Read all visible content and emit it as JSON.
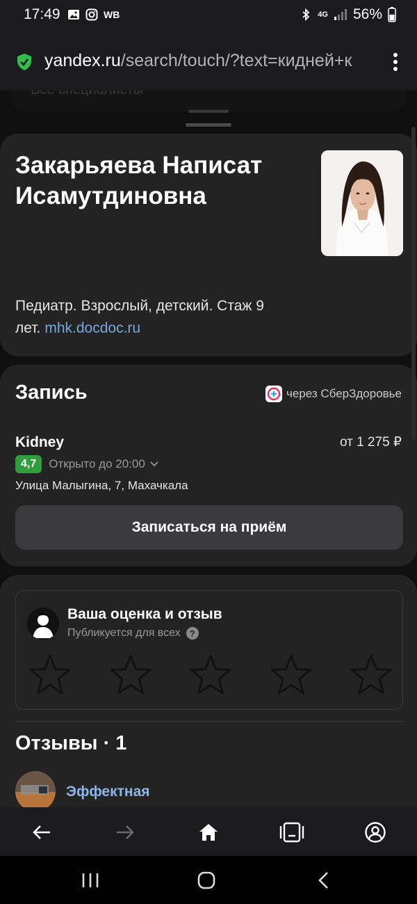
{
  "status_bar": {
    "time": "17:49",
    "carrier_label": "WB",
    "network": "4G",
    "battery": "56%"
  },
  "browser": {
    "url_host": "yandex.ru",
    "url_path": "/search/touch/?text=кидней+к"
  },
  "background_sheet": {
    "label": "Все специалисты"
  },
  "doctor": {
    "name": "Закарьяева Написат Исамутдиновна",
    "description": "Педиатр. Взрослый, детский. Стаж 9 лет.",
    "source_link": "mhk.docdoc.ru"
  },
  "booking": {
    "title": "Запись",
    "via": "через СберЗдоровье",
    "clinic_name": "Kidney",
    "price": "от 1 275 ₽",
    "rating": "4,7",
    "open_status": "Открыто до 20:00",
    "address": "Улица Малыгина, 7, Махачкала",
    "book_button": "Записаться на приём"
  },
  "rate": {
    "title": "Ваша оценка и отзыв",
    "subtitle": "Публикуется для всех",
    "stars_total": 5,
    "stars_selected": 0
  },
  "reviews": {
    "title": "Отзывы · 1",
    "first_author": "Эффектная"
  },
  "colors": {
    "link": "#76a9e0",
    "rating_badge": "#2f9d3b",
    "card_bg": "#232323",
    "author_link": "#8ab6e8"
  }
}
